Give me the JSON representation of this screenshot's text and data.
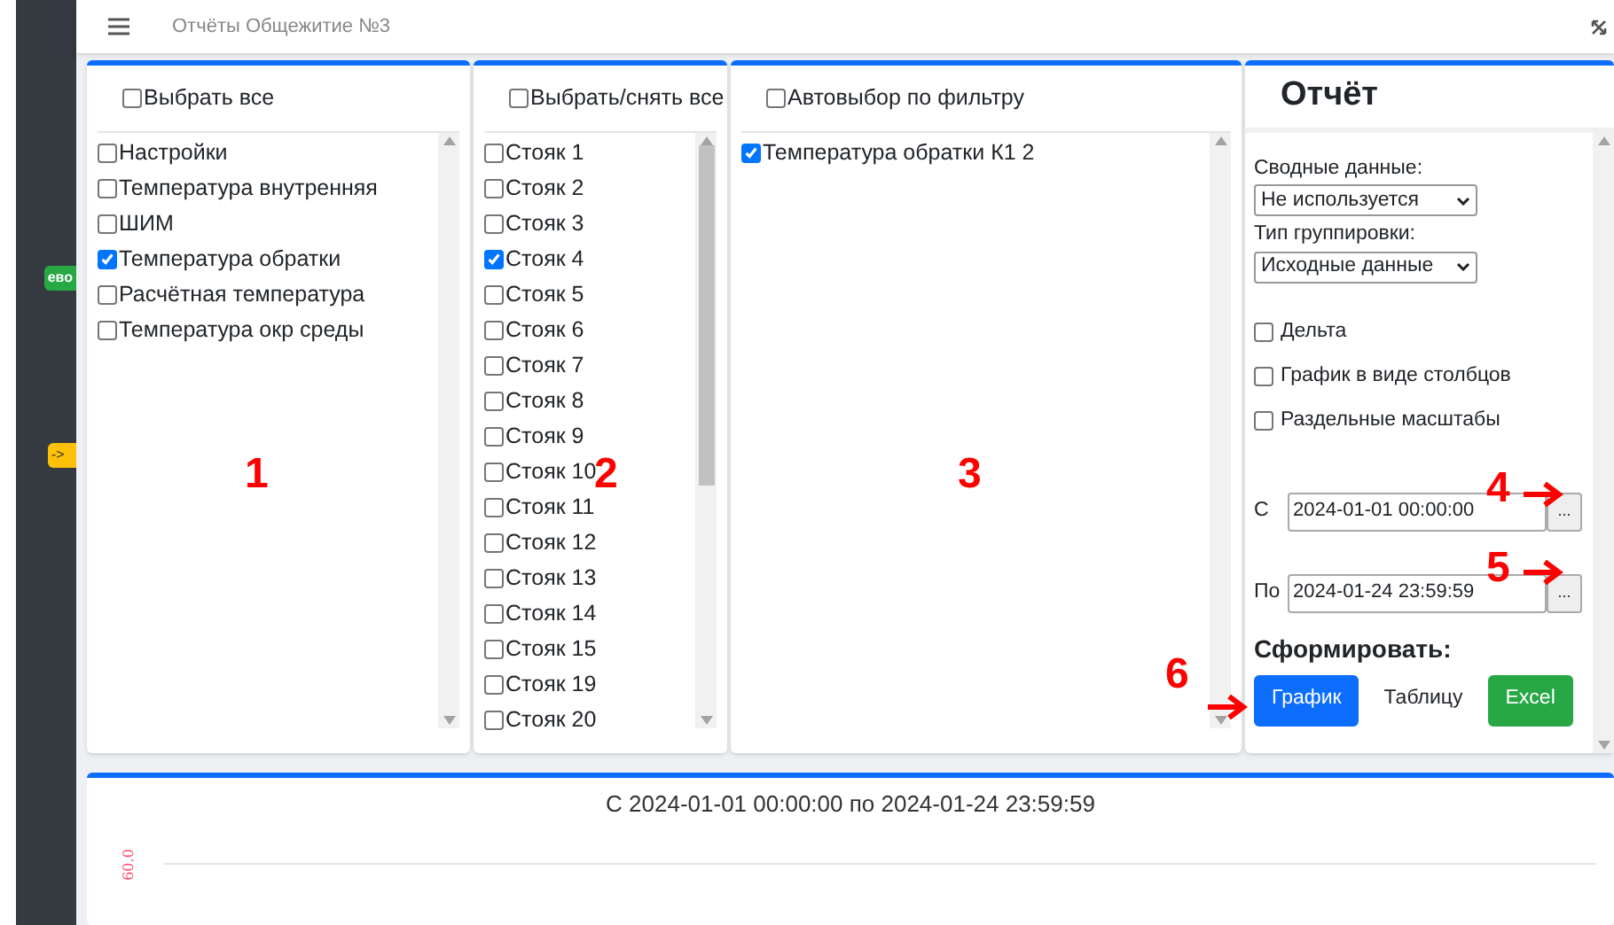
{
  "header": {
    "title": "Отчёты Общежитие №3"
  },
  "sidebar": {
    "badges": [
      {
        "text": "ево",
        "color": "#28a745"
      },
      {
        "text": "->",
        "color": "#ffc107"
      }
    ]
  },
  "parameters": {
    "select_all": {
      "label": "Выбрать все",
      "checked": false
    },
    "items": [
      {
        "label": "Настройки",
        "checked": false
      },
      {
        "label": "Температура внутренняя",
        "checked": false
      },
      {
        "label": "ШИМ",
        "checked": false
      },
      {
        "label": "Температура обратки",
        "checked": true
      },
      {
        "label": "Расчётная температура",
        "checked": false
      },
      {
        "label": "Температура окр среды",
        "checked": false
      }
    ]
  },
  "risers": {
    "select_all": {
      "label": "Выбрать/снять все",
      "checked": false
    },
    "items": [
      {
        "label": "Стояк 1",
        "checked": false
      },
      {
        "label": "Стояк 2",
        "checked": false
      },
      {
        "label": "Стояк 3",
        "checked": false
      },
      {
        "label": "Стояк 4",
        "checked": true
      },
      {
        "label": "Стояк 5",
        "checked": false
      },
      {
        "label": "Стояк 6",
        "checked": false
      },
      {
        "label": "Стояк 7",
        "checked": false
      },
      {
        "label": "Стояк 8",
        "checked": false
      },
      {
        "label": "Стояк 9",
        "checked": false
      },
      {
        "label": "Стояк 10",
        "checked": false
      },
      {
        "label": "Стояк 11",
        "checked": false
      },
      {
        "label": "Стояк 12",
        "checked": false
      },
      {
        "label": "Стояк 13",
        "checked": false
      },
      {
        "label": "Стояк 14",
        "checked": false
      },
      {
        "label": "Стояк 15",
        "checked": false
      },
      {
        "label": "Стояк 19",
        "checked": false
      },
      {
        "label": "Стояк 20",
        "checked": false
      }
    ]
  },
  "selection": {
    "auto_select": {
      "label": "Автовыбор по фильтру",
      "checked": false
    },
    "items": [
      {
        "label": "Температура обратки К1 2",
        "checked": true
      }
    ]
  },
  "report": {
    "title": "Отчёт",
    "summary": {
      "label": "Сводные данные:",
      "value": "Не используется"
    },
    "grouping": {
      "label": "Тип группировки:",
      "value": "Исходные данные"
    },
    "options": [
      {
        "label": "Дельта",
        "checked": false
      },
      {
        "label": "График в виде столбцов",
        "checked": false
      },
      {
        "label": "Раздельные масштабы",
        "checked": false
      }
    ],
    "from": {
      "label": "С",
      "value": "2024-01-01 00:00:00",
      "button": "..."
    },
    "to": {
      "label": "По",
      "value": "2024-01-24 23:59:59",
      "button": "..."
    },
    "generate_label": "Сформировать:",
    "buttons": [
      {
        "label": "График",
        "kind": "primary"
      },
      {
        "label": "Таблицу",
        "kind": "link"
      },
      {
        "label": "Excel",
        "kind": "success"
      }
    ]
  },
  "annotations": [
    "1",
    "2",
    "3",
    "4",
    "5",
    "6"
  ],
  "chart": {
    "title": "С 2024-01-01 00:00:00 по 2024-01-24 23:59:59",
    "y_tick": "60.0"
  }
}
